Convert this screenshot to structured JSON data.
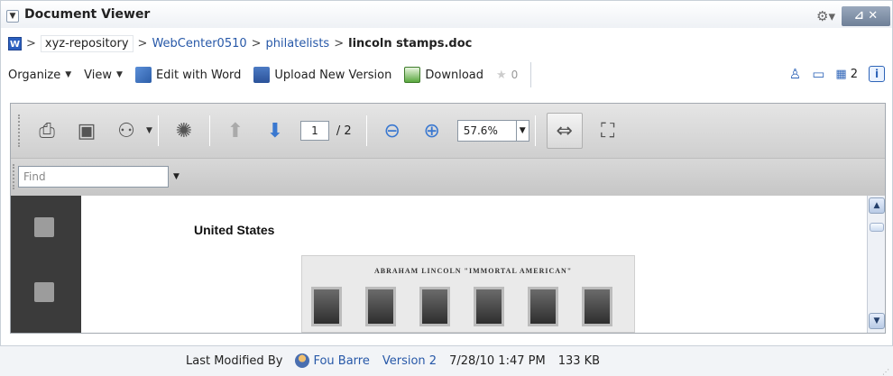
{
  "panel": {
    "title": "Document Viewer",
    "settings_icon": "gear-icon",
    "window_buttons_label": "⊿ ✕"
  },
  "breadcrumb": {
    "items": [
      {
        "label": "xyz-repository"
      },
      {
        "label": "WebCenter0510"
      },
      {
        "label": "philatelists"
      },
      {
        "label": "lincoln stamps.doc"
      }
    ]
  },
  "menubar": {
    "organize": "Organize",
    "view": "View",
    "edit_with_word": "Edit with Word",
    "upload_new_version": "Upload New Version",
    "download": "Download",
    "rating_count": "0",
    "attachments_count": "2"
  },
  "viewer": {
    "current_page": "1",
    "total_pages": "/ 2",
    "zoom": "57.6%",
    "find_placeholder": "Find"
  },
  "document": {
    "heading": "United States",
    "image_caption": "ABRAHAM LINCOLN \"IMMORTAL AMERICAN\""
  },
  "footer": {
    "last_modified_label": "Last Modified By",
    "user": "Fou Barre",
    "version": "Version 2",
    "date": "7/28/10 1:47 PM",
    "size": "133 KB"
  }
}
